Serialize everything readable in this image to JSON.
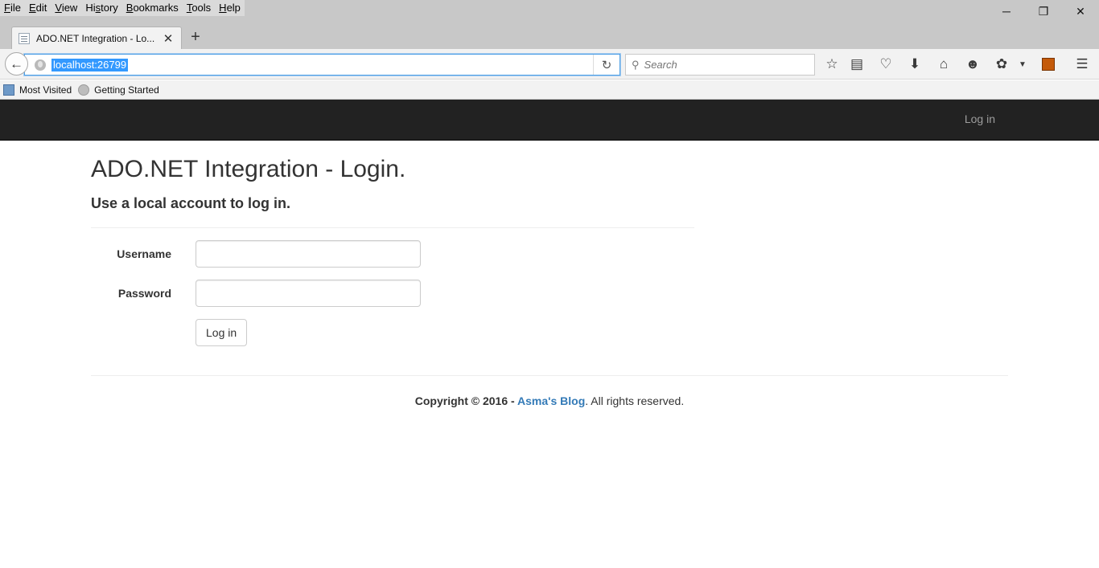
{
  "menu": [
    {
      "accel": "F",
      "rest": "ile"
    },
    {
      "accel": "E",
      "rest": "dit"
    },
    {
      "accel": "V",
      "rest": "iew"
    },
    {
      "pre": "Hi",
      "accel": "s",
      "rest": "tory"
    },
    {
      "accel": "B",
      "rest": "ookmarks"
    },
    {
      "accel": "T",
      "rest": "ools"
    },
    {
      "accel": "H",
      "rest": "elp"
    }
  ],
  "menu_labels": [
    "File",
    "Edit",
    "View",
    "History",
    "Bookmarks",
    "Tools",
    "Help"
  ],
  "window_controls": {
    "minimize": "─",
    "restore": "❐",
    "close": "✕"
  },
  "tab": {
    "title": "ADO.NET Integration - Lo...",
    "close": "✕",
    "new_tab": "+"
  },
  "urlbar": {
    "url": "localhost:26799"
  },
  "searchbar": {
    "placeholder": "Search"
  },
  "toolbar_icons": [
    "star-icon",
    "reader-icon",
    "pocket-icon",
    "download-icon",
    "home-icon",
    "chat-icon",
    "extension-icon",
    "dropdown-icon",
    "addon-icon",
    "hamburger-menu-icon"
  ],
  "bookmarks": [
    {
      "label": "Most Visited",
      "icon": "most-visited-icon"
    },
    {
      "label": "Getting Started",
      "icon": "getting-started-icon"
    }
  ],
  "site_nav": {
    "login_link": "Log in"
  },
  "page": {
    "title": "ADO.NET Integration - Login.",
    "subtitle": "Use a local account to log in.",
    "username_label": "Username",
    "password_label": "Password",
    "submit_label": "Log in"
  },
  "footer": {
    "prefix": "Copyright © 2016 - ",
    "link": "Asma's Blog",
    "suffix": ". All rights reserved."
  },
  "colors": {
    "nav_bg": "#222222",
    "link": "#337ab7",
    "url_highlight": "#3399ff"
  }
}
